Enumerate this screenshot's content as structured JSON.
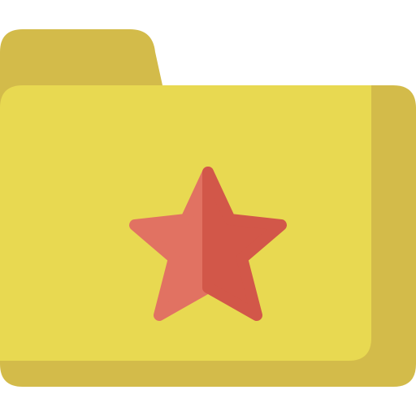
{
  "icon": {
    "name": "favorite-folder-icon",
    "colors": {
      "folder_back": "#D3BB4A",
      "folder_front": "#E8D951",
      "star_left": "#E17262",
      "star_right": "#D25749"
    }
  }
}
